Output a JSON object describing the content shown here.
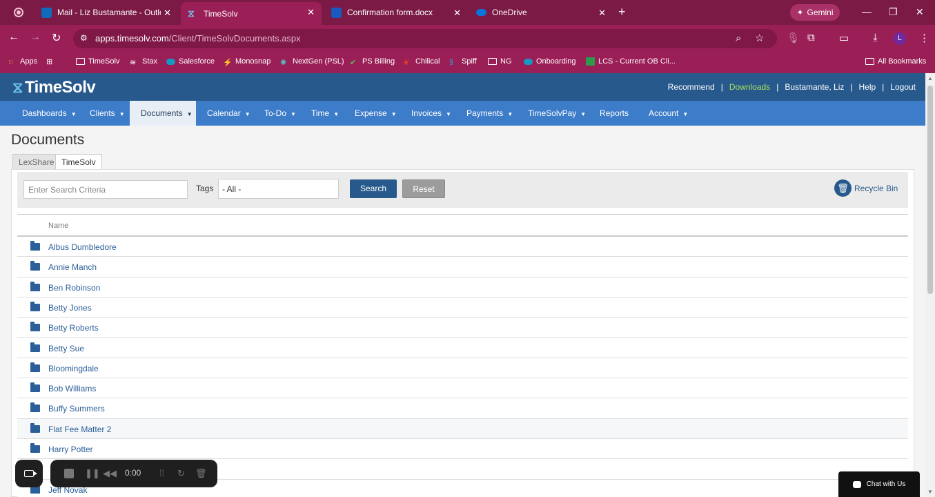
{
  "browser": {
    "tabs": [
      {
        "title": "Mail - Liz Bustamante - Outlook",
        "icon_color": "#0f6cbd"
      },
      {
        "title": "TimeSolv",
        "icon_color": "#6fc3ee"
      },
      {
        "title": "Confirmation form.docx",
        "icon_color": "#185abd"
      },
      {
        "title": "OneDrive",
        "icon_color": "#0a74da"
      }
    ],
    "gemini_label": "Gemini",
    "url_host": "apps.timesolv.com",
    "url_path": "/Client/TimeSolvDocuments.aspx",
    "profile_initial": "L",
    "bookmarks": [
      "Apps",
      "TimeSolv",
      "Stax",
      "Salesforce",
      "Monosnap",
      "NextGen (PSL)",
      "PS Billing",
      "Chilical",
      "Spiff",
      "NG",
      "Onboarding",
      "LCS - Current OB Cli..."
    ],
    "all_bookmarks": "All Bookmarks"
  },
  "app": {
    "logo": "TimeSolv",
    "toplinks": {
      "recommend": "Recommend",
      "downloads": "Downloads",
      "user": "Bustamante, Liz",
      "help": "Help",
      "logout": "Logout"
    },
    "nav": [
      {
        "label": "Dashboards",
        "caret": true
      },
      {
        "label": "Clients",
        "caret": true
      },
      {
        "label": "Documents",
        "caret": true,
        "active": true
      },
      {
        "label": "Calendar",
        "caret": true
      },
      {
        "label": "To-Do",
        "caret": true
      },
      {
        "label": "Time",
        "caret": true
      },
      {
        "label": "Expense",
        "caret": true
      },
      {
        "label": "Invoices",
        "caret": true
      },
      {
        "label": "Payments",
        "caret": true
      },
      {
        "label": "TimeSolvPay",
        "caret": true
      },
      {
        "label": "Reports",
        "caret": false
      },
      {
        "label": "Account",
        "caret": true
      }
    ]
  },
  "page": {
    "title": "Documents",
    "subtabs": [
      "LexShare",
      "TimeSolv"
    ],
    "search": {
      "placeholder": "Enter Search Criteria",
      "tags_label": "Tags",
      "tags_value": "- All -",
      "search_button": "Search",
      "reset_button": "Reset",
      "recycle_bin": "Recycle Bin"
    },
    "table": {
      "header": "Name",
      "rows": [
        "Albus Dumbledore",
        "Annie Manch",
        "Ben Robinson",
        "Betty Jones",
        "Betty Roberts",
        "Betty Sue",
        "Bloomingdale",
        "Bob Williams",
        "Buffy Summers",
        "Flat Fee Matter 2",
        "Harry Potter",
        "",
        "Jeff Novak"
      ]
    }
  },
  "recorder": {
    "time": "0:00"
  },
  "chat_label": "Chat with Us"
}
